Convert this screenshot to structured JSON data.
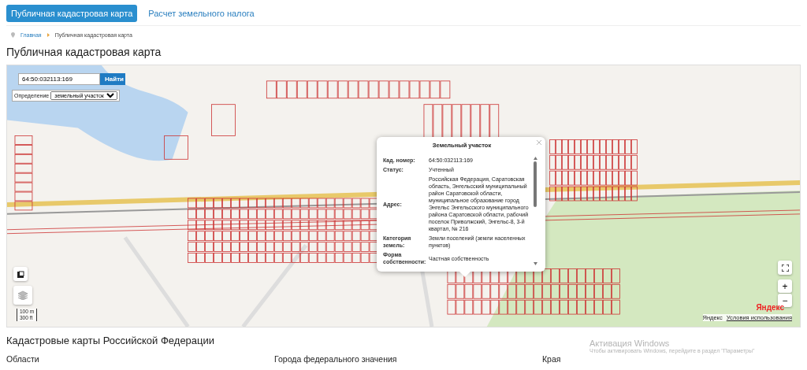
{
  "tabs": [
    {
      "label": "Публичная кадастровая карта",
      "selected": true
    },
    {
      "label": "Расчет земельного налога",
      "selected": false
    }
  ],
  "breadcrumbs": [
    "Главная",
    "Публичная кадастровая карта"
  ],
  "page_title": "Публичная кадастровая карта",
  "map": {
    "search": {
      "value": "64:50:032113:169",
      "button": "Найти"
    },
    "identify": {
      "label": "Определение",
      "value": "земельный участок"
    },
    "popup": {
      "title": "Земельный участок",
      "fields": [
        {
          "label": "Кад. номер:",
          "value": "64:50:032113:169"
        },
        {
          "label": "Статус:",
          "value": "Учтенный"
        },
        {
          "label": "Адрес:",
          "value": "Российская Федерация, Саратовская область, Энгельсский муниципальный район Саратовской области, муниципальное образование город Энгельс Энгельсского муниципального района Саратовской области, рабочий поселок Приволжский, Энгельс-8, 3-й квартал, № 216"
        },
        {
          "label": "Категория земель:",
          "value": "Земли поселений (земли населенных пунктов)"
        },
        {
          "label": "Форма собственности:",
          "value": "Частная собственность"
        }
      ]
    },
    "zoom_in": "+",
    "zoom_out": "−",
    "scale": [
      "100 m",
      "300 ft"
    ],
    "logo": "Яндекс",
    "attribution": {
      "brand": "Яндекс",
      "terms": "Условия использования"
    }
  },
  "section_title": "Кадастровые карты Российской Федерации",
  "columns": [
    "Области",
    "Города федерального значения",
    "Края"
  ],
  "os_notice": {
    "title": "Активация Windows",
    "text": "Чтобы активировать Windows, перейдите в раздел \"Параметры\""
  }
}
